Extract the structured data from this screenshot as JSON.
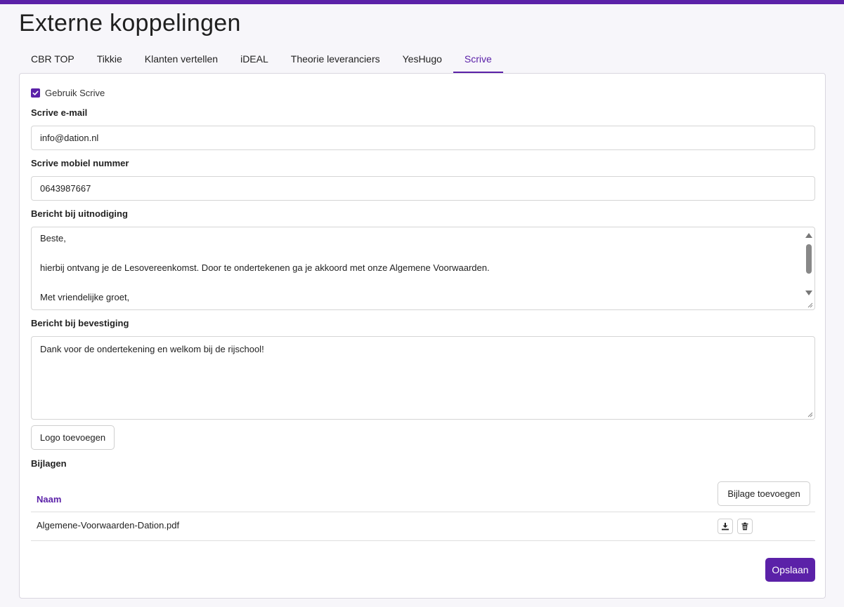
{
  "page": {
    "title": "Externe koppelingen"
  },
  "tabs": [
    {
      "label": "CBR TOP",
      "active": false
    },
    {
      "label": "Tikkie",
      "active": false
    },
    {
      "label": "Klanten vertellen",
      "active": false
    },
    {
      "label": "iDEAL",
      "active": false
    },
    {
      "label": "Theorie leveranciers",
      "active": false
    },
    {
      "label": "YesHugo",
      "active": false
    },
    {
      "label": "Scrive",
      "active": true
    }
  ],
  "form": {
    "use_scrive": {
      "label": "Gebruik Scrive",
      "checked": true
    },
    "email": {
      "label": "Scrive e-mail",
      "value": "info@dation.nl"
    },
    "mobile": {
      "label": "Scrive mobiel nummer",
      "value": "0643987667"
    },
    "invitation": {
      "label": "Bericht bij uitnodiging",
      "lines": [
        "Beste,",
        "",
        "hierbij ontvang je de Lesovereenkomst. Door te ondertekenen ga je akkoord met onze Algemene Voorwaarden.",
        "",
        "Met vriendelijke groet,"
      ]
    },
    "confirmation": {
      "label": "Bericht bij bevestiging",
      "value": "Dank voor de ondertekening en welkom bij de rijschool!"
    },
    "add_logo_label": "Logo toevoegen"
  },
  "attachments": {
    "title": "Bijlagen",
    "column_name": "Naam",
    "add_label": "Bijlage toevoegen",
    "rows": [
      {
        "name": "Algemene-Voorwaarden-Dation.pdf"
      }
    ]
  },
  "save_label": "Opslaan",
  "colors": {
    "accent": "#5b21a8",
    "background": "#f7f6fa",
    "border": "#d9d6df"
  },
  "icons": [
    "check-icon",
    "download-icon",
    "trash-icon",
    "scroll-up-icon",
    "scroll-down-icon",
    "resize-grip-icon"
  ]
}
